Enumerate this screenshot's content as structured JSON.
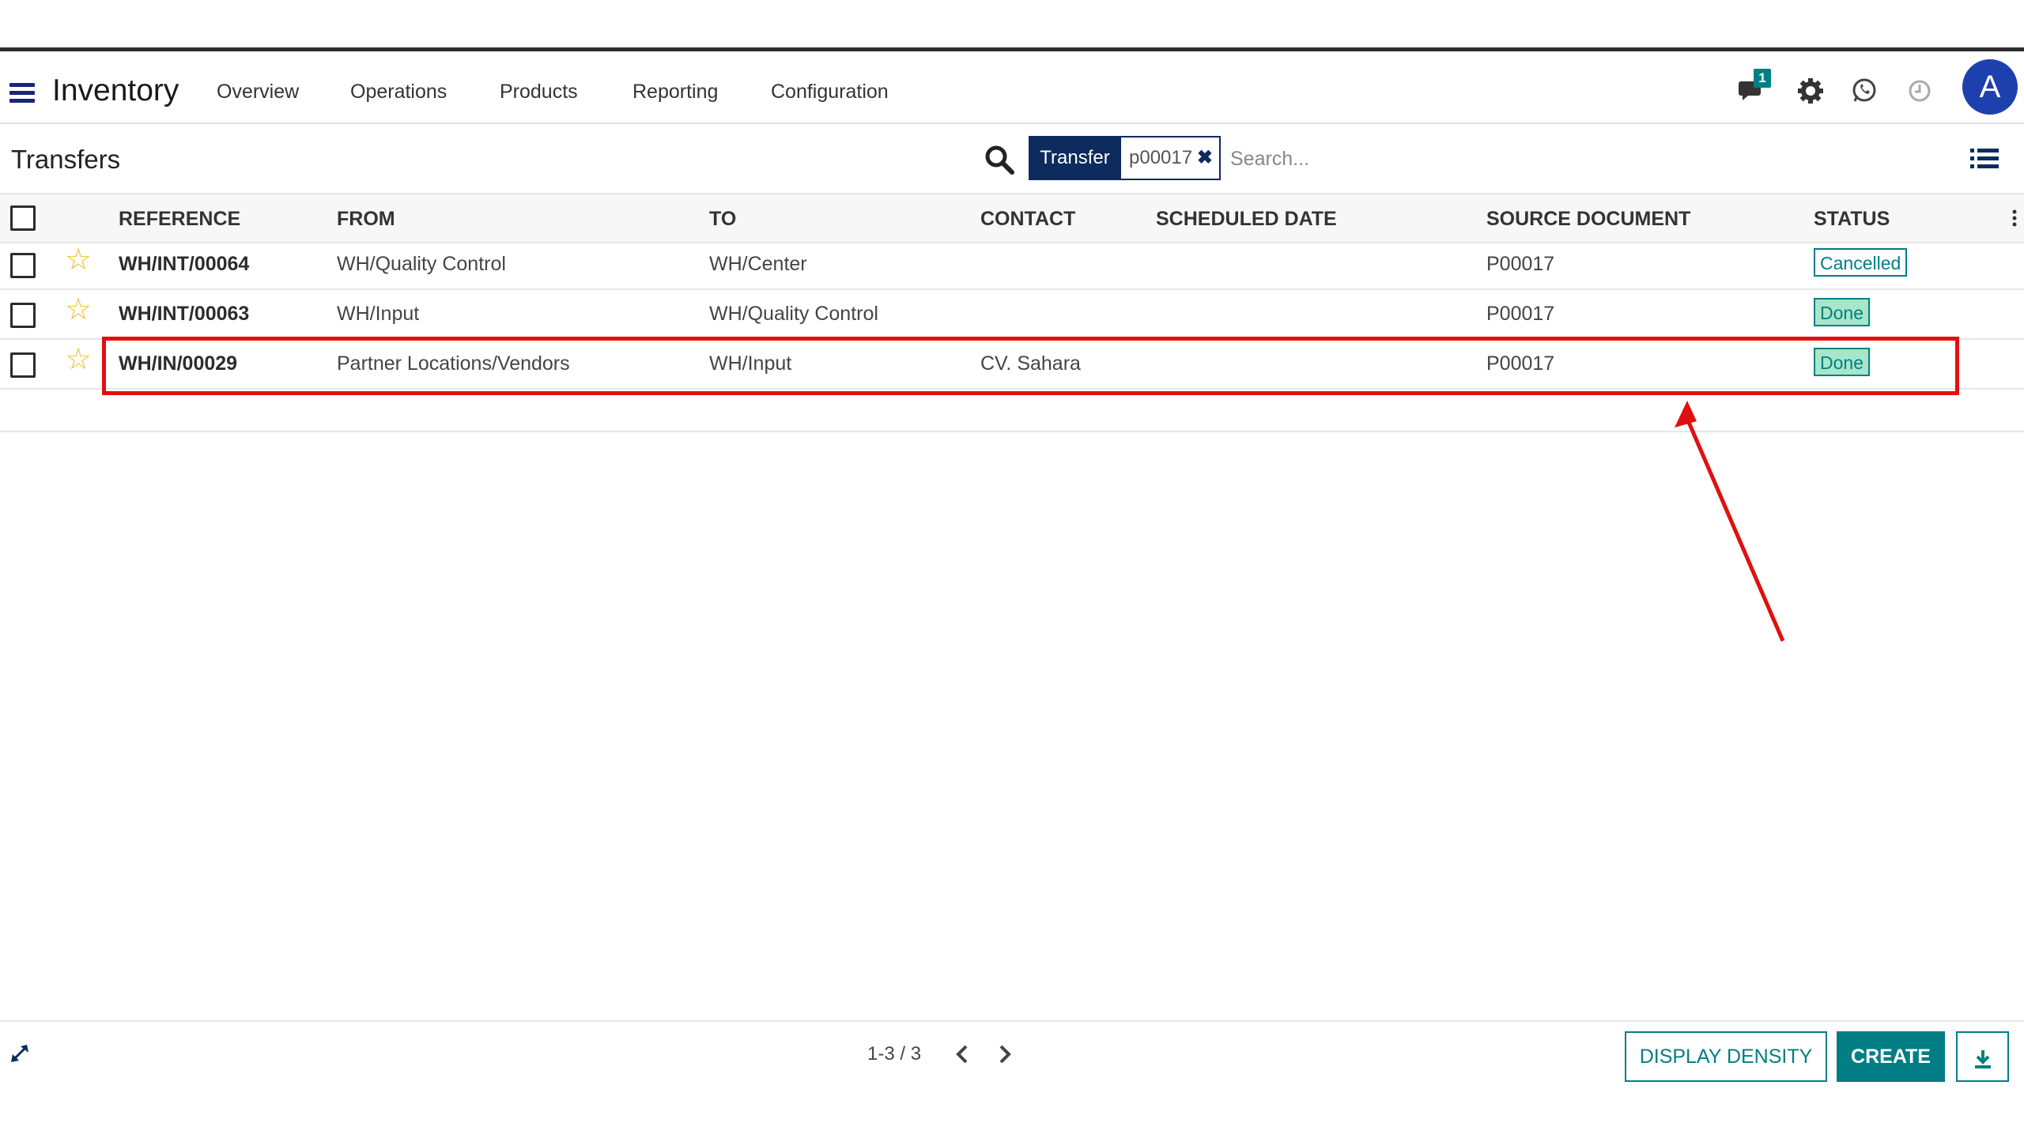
{
  "app": {
    "title": "Inventory"
  },
  "nav": {
    "items": [
      "Overview",
      "Operations",
      "Products",
      "Reporting",
      "Configuration"
    ]
  },
  "systray": {
    "messages_count": "1",
    "avatar_letter": "A"
  },
  "control_panel": {
    "title": "Transfers",
    "facet": {
      "label": "Transfer",
      "value": "p00017"
    },
    "search_placeholder": "Search..."
  },
  "table": {
    "columns": [
      "REFERENCE",
      "FROM",
      "TO",
      "CONTACT",
      "SCHEDULED DATE",
      "SOURCE DOCUMENT",
      "STATUS"
    ],
    "rows": [
      {
        "reference": "WH/INT/00064",
        "from": "WH/Quality Control",
        "to": "WH/Center",
        "contact": "",
        "scheduled_date": "",
        "source": "P00017",
        "status": "Cancelled"
      },
      {
        "reference": "WH/INT/00063",
        "from": "WH/Input",
        "to": "WH/Quality Control",
        "contact": "",
        "scheduled_date": "",
        "source": "P00017",
        "status": "Done"
      },
      {
        "reference": "WH/IN/00029",
        "from": "Partner Locations/Vendors",
        "to": "WH/Input",
        "contact": "CV. Sahara",
        "scheduled_date": "",
        "source": "P00017",
        "status": "Done"
      }
    ]
  },
  "pager": {
    "value": "1-3 / 3"
  },
  "buttons": {
    "display_density": "DISPLAY DENSITY",
    "create": "CREATE"
  },
  "colors": {
    "accent": "#017e84",
    "facet_bg": "#0d2b5c",
    "annotation": "#e01010",
    "avatar": "#1e40af"
  }
}
